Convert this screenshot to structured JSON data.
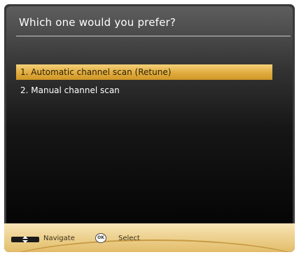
{
  "dialog": {
    "title": "Which one would you prefer?",
    "options": [
      {
        "label": "1. Automatic channel scan (Retune)",
        "selected": true
      },
      {
        "label": "2. Manual channel scan",
        "selected": false
      }
    ]
  },
  "footer": {
    "navigate_label": "Navigate",
    "ok_icon_text": "OK",
    "select_label": "Select"
  },
  "colors": {
    "highlight": "#e1ac3f",
    "footer": "#eccf8b",
    "panel_dark": "#050505"
  }
}
